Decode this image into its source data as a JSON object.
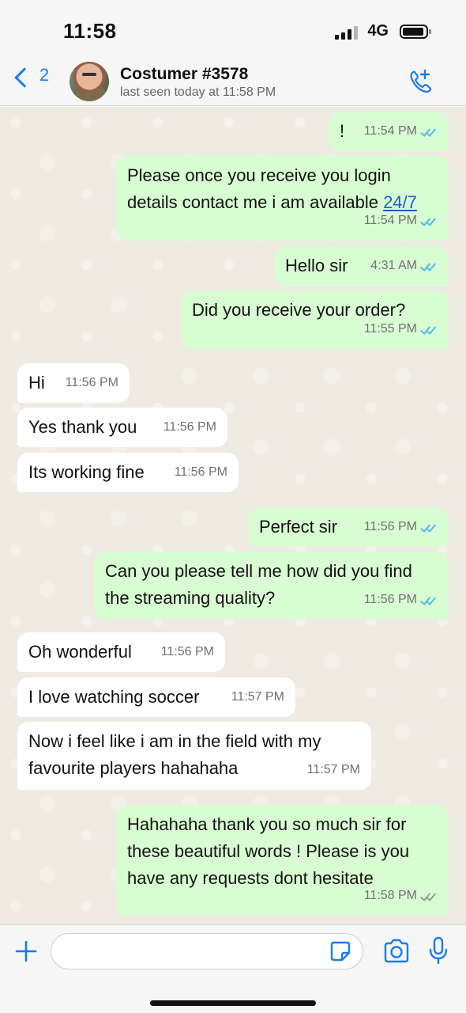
{
  "status_bar": {
    "time": "11:58",
    "network": "4G"
  },
  "header": {
    "back_count": "2",
    "contact_name": "Costumer #3578",
    "contact_status": "last seen today at 11:58 PM"
  },
  "messages": [
    {
      "dir": "out",
      "text": "!",
      "time": "11:54 PM",
      "ticks": "read"
    },
    {
      "dir": "out",
      "text_before": "Please once you receive you login details contact me i am available ",
      "link": "24/7",
      "time": "11:54 PM",
      "ticks": "read"
    },
    {
      "dir": "out",
      "text": "Hello sir",
      "time": "4:31 AM",
      "ticks": "read"
    },
    {
      "dir": "out",
      "text": "Did you receive your order?",
      "time": "11:55 PM",
      "ticks": "read"
    },
    {
      "dir": "in",
      "text": "Hi",
      "time": "11:56 PM"
    },
    {
      "dir": "in",
      "text": "Yes thank you",
      "time": "11:56 PM"
    },
    {
      "dir": "in",
      "text": "Its working fine",
      "time": "11:56 PM"
    },
    {
      "dir": "out",
      "text": "Perfect sir",
      "time": "11:56 PM",
      "ticks": "read"
    },
    {
      "dir": "out",
      "text": "Can you please tell me how did you find the streaming quality?",
      "time": "11:56 PM",
      "ticks": "read"
    },
    {
      "dir": "in",
      "text": "Oh wonderful",
      "time": "11:56 PM"
    },
    {
      "dir": "in",
      "text": "I love watching soccer",
      "time": "11:57 PM"
    },
    {
      "dir": "in",
      "text": "Now i feel like i am in the field with my favourite players hahahaha",
      "time": "11:57 PM"
    },
    {
      "dir": "out",
      "text": "Hahahaha thank you so much sir for these beautiful words ! Please is you have any requests dont hesitate",
      "time": "11:58 PM",
      "ticks": "delivered"
    }
  ],
  "input": {
    "placeholder": ""
  },
  "colors": {
    "accent": "#1a7cf0",
    "outgoing_bubble": "#d9fdd3",
    "incoming_bubble": "#ffffff",
    "read_tick": "#53bdeb"
  },
  "icons": [
    "back-chevron-icon",
    "call-add-icon",
    "plus-icon",
    "sticker-icon",
    "camera-icon",
    "mic-icon"
  ]
}
